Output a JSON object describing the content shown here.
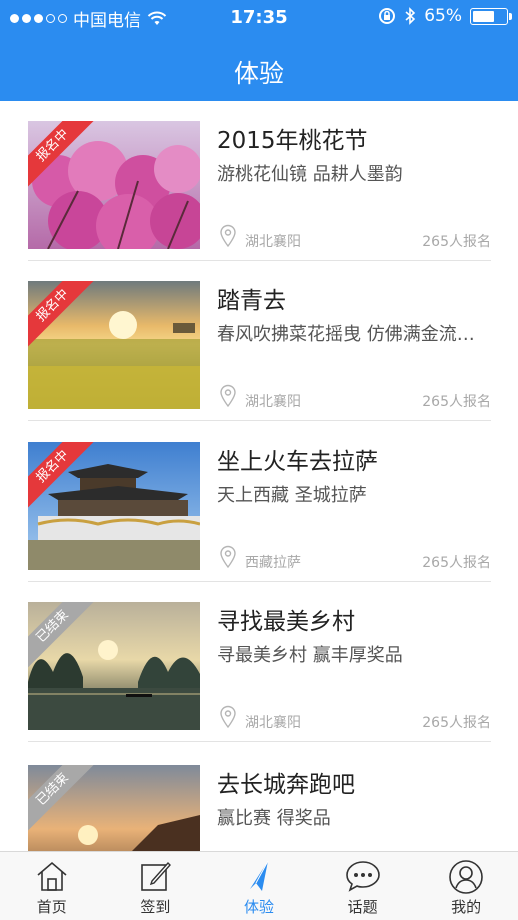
{
  "status_bar": {
    "carrier": "中国电信",
    "time": "17:35",
    "battery": "65%",
    "battery_level": 0.65
  },
  "nav": {
    "title": "体验"
  },
  "items": [
    {
      "title": "2015年桃花节",
      "subtitle": "游桃花仙镜  品耕人墨韵",
      "location": "湖北襄阳",
      "count": "265人报名",
      "status": "报名中"
    },
    {
      "title": "踏青去",
      "subtitle": "春风吹拂菜花摇曳  仿佛满金流…",
      "location": "湖北襄阳",
      "count": "265人报名",
      "status": "报名中"
    },
    {
      "title": "坐上火车去拉萨",
      "subtitle": "天上西藏  圣城拉萨",
      "location": "西藏拉萨",
      "count": "265人报名",
      "status": "报名中"
    },
    {
      "title": "寻找最美乡村",
      "subtitle": "寻最美乡村  赢丰厚奖品",
      "location": "湖北襄阳",
      "count": "265人报名",
      "status": "已结束"
    },
    {
      "title": "去长城奔跑吧",
      "subtitle": "赢比赛  得奖品",
      "status": "已结束"
    }
  ],
  "tabs": [
    {
      "label": "首页",
      "icon": "home-icon"
    },
    {
      "label": "签到",
      "icon": "checkin-icon"
    },
    {
      "label": "体验",
      "icon": "paper-plane-icon",
      "active": true
    },
    {
      "label": "话题",
      "icon": "chat-bubble-icon"
    },
    {
      "label": "我的",
      "icon": "user-icon"
    }
  ],
  "colors": {
    "primary": "#2b8cf0",
    "ribbon_active": "#e5383b",
    "ribbon_ended": "#a8a8a8"
  }
}
